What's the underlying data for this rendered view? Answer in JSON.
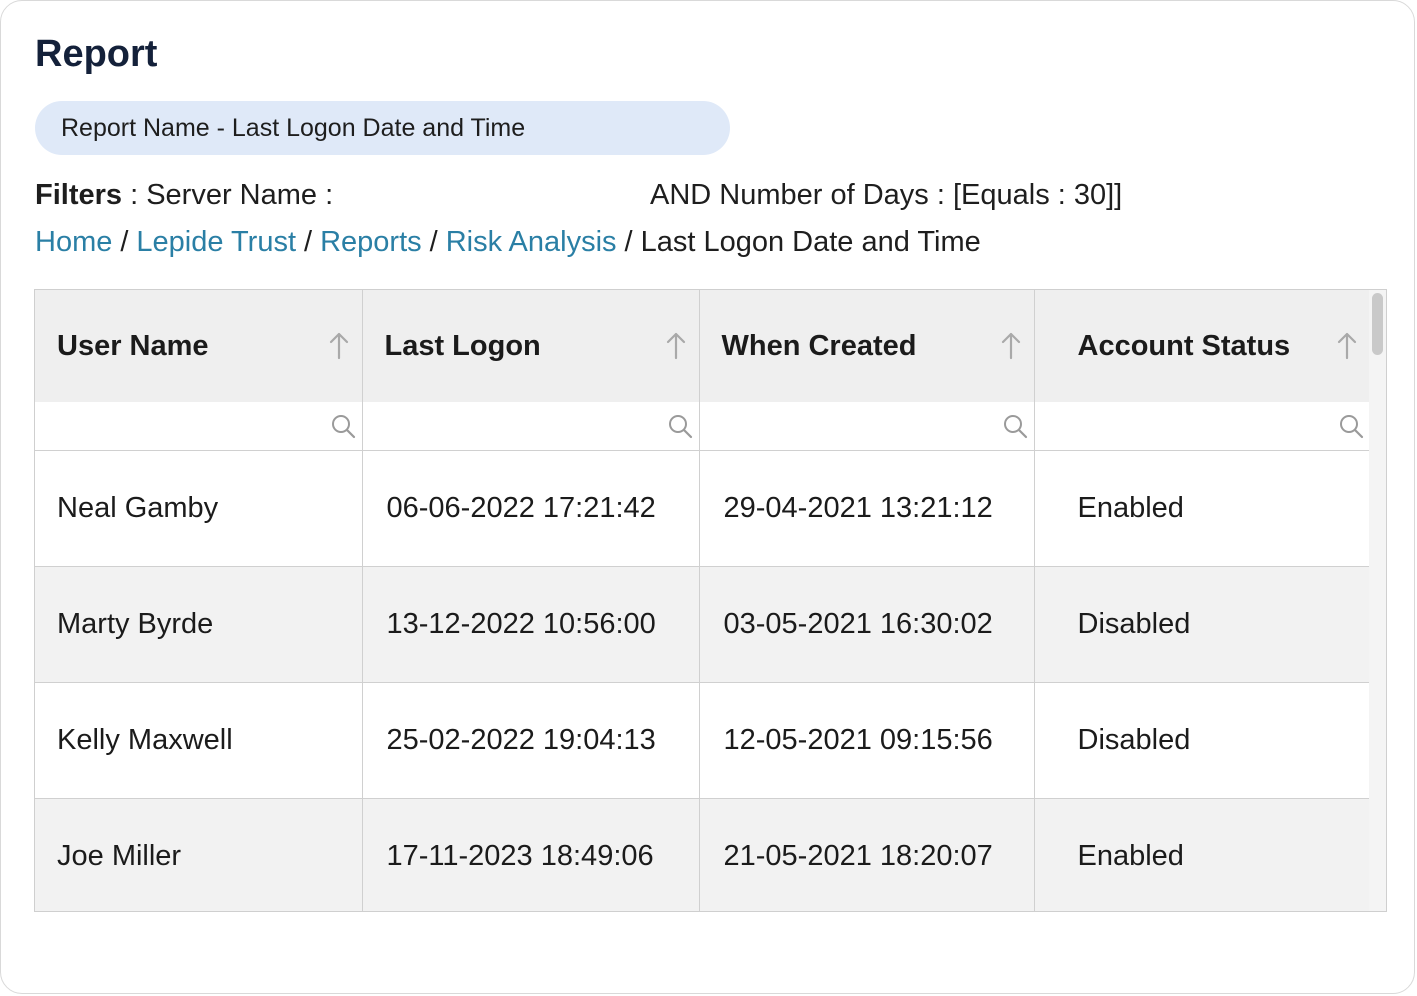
{
  "page": {
    "title": "Report",
    "report_name": "Report Name - Last Logon Date and Time"
  },
  "filters": {
    "label": "Filters",
    "server_name": ": Server Name :",
    "days": "AND Number of Days : [Equals : 30]]"
  },
  "breadcrumb": {
    "items": [
      "Home",
      "Lepide Trust",
      "Reports",
      "Risk Analysis"
    ],
    "current": "Last Logon Date and Time",
    "separator": "/"
  },
  "table": {
    "columns": [
      "User Name",
      "Last Logon",
      "When Created",
      "Account Status"
    ],
    "rows": [
      [
        "Neal Gamby",
        "06-06-2022 17:21:42",
        "29-04-2021 13:21:12",
        "Enabled"
      ],
      [
        "Marty Byrde",
        "13-12-2022 10:56:00",
        "03-05-2021 16:30:02",
        "Disabled"
      ],
      [
        "Kelly Maxwell",
        "25-02-2022 19:04:13",
        "12-05-2021 09:15:56",
        "Disabled"
      ],
      [
        "Joe Miller",
        "17-11-2023 18:49:06",
        "21-05-2021 18:20:07",
        "Enabled"
      ]
    ]
  },
  "colors": {
    "title": "#14213a",
    "pill_background": "#dfe9f8",
    "link": "#2a7fa5",
    "header_background": "#efefef",
    "alt_row_background": "#f2f2f2"
  },
  "icons": {
    "sort": "arrow-up-icon",
    "search": "magnifier-icon"
  }
}
